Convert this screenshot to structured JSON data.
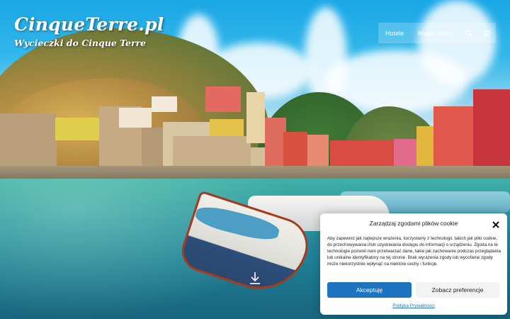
{
  "header": {
    "site_title": "CinqueTerre.pl",
    "tagline": "Wycieczki do Cinque Terre",
    "nav": [
      {
        "label": "Hotele"
      },
      {
        "label": "Mapa strony"
      }
    ],
    "icons": [
      "search-icon",
      "menu-icon"
    ]
  },
  "hero": {
    "scroll_icon": "arrow-down-icon",
    "scene": "harbour with colourful houses and boats"
  },
  "cookie_banner": {
    "title": "Zarządzaj zgodami plików cookie",
    "body": "Aby zapewnić jak najlepsze wrażenia, korzystamy z technologii, takich jak pliki cookie, do przechowywania i/lub uzyskiwania dostępu do informacji o urządzeniu. Zgoda na te technologie pozwoli nam przetwarzać dane, takie jak zachowanie podczas przeglądania lub unikalne identyfikatory na tej stronie. Brak wyrażenia zgody lub wycofanie zgody może niekorzystnie wpłynąć na niektóre cechy i funkcje.",
    "accept_label": "Akceptuję",
    "preferences_label": "Zobacz preferencje",
    "policy_link": "Polityka Prywatności",
    "accent_color": "#1e73be"
  }
}
